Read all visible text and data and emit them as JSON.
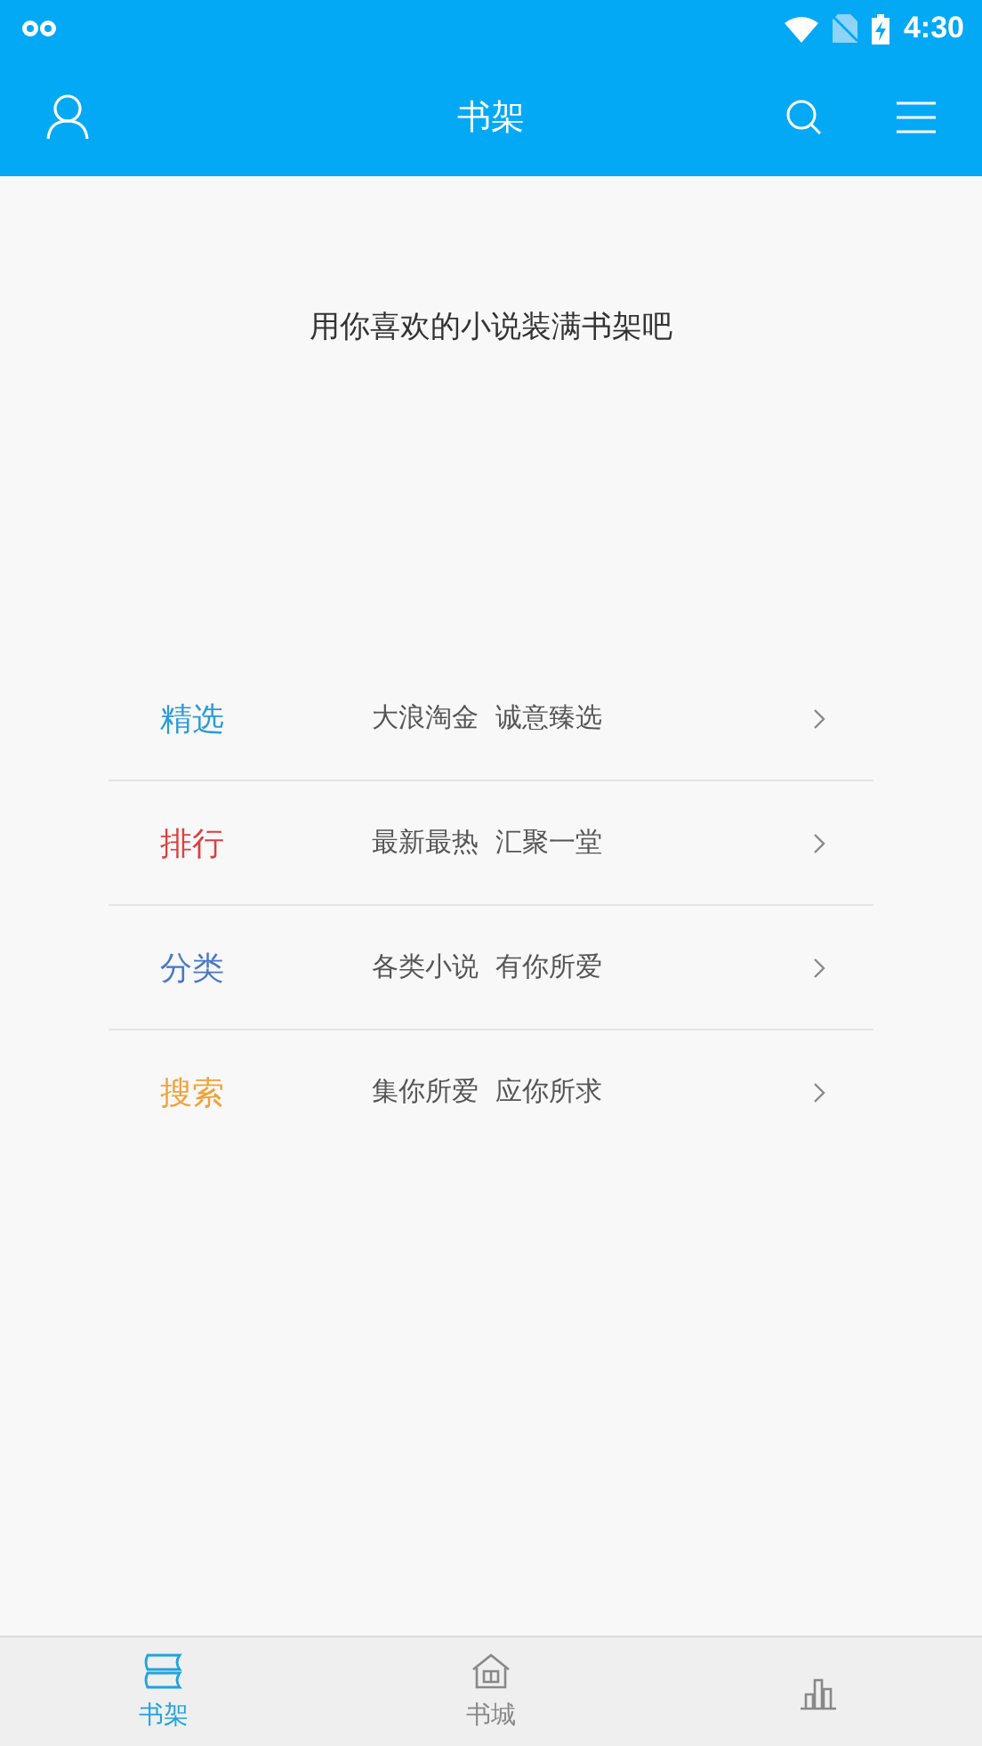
{
  "status_bar": {
    "time": "4:30"
  },
  "header": {
    "title": "书架"
  },
  "empty_message": "用你喜欢的小说装满书架吧",
  "entries": [
    {
      "title": "精选",
      "subtitle": "大浪淘金  诚意臻选",
      "color": "#2a9ad6"
    },
    {
      "title": "排行",
      "subtitle": "最新最热  汇聚一堂",
      "color": "#d9413f"
    },
    {
      "title": "分类",
      "subtitle": "各类小说  有你所爱",
      "color": "#4a78c8"
    },
    {
      "title": "搜索",
      "subtitle": "集你所爱  应你所求",
      "color": "#f0a23a"
    }
  ],
  "bottom_nav": [
    {
      "kind": "shelf",
      "label": "书架",
      "selected": true
    },
    {
      "kind": "store",
      "label": "书城",
      "selected": false
    },
    {
      "kind": "rank",
      "selected": false
    }
  ]
}
